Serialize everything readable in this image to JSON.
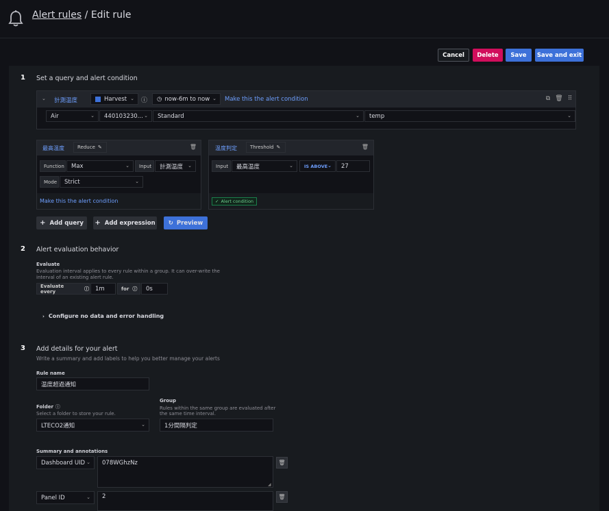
{
  "header": {
    "breadcrumb_link": "Alert rules",
    "breadcrumb_sep": " / ",
    "breadcrumb_current": "Edit rule"
  },
  "toolbar": {
    "cancel": "Cancel",
    "delete": "Delete",
    "save": "Save",
    "save_exit": "Save and exit"
  },
  "step1": {
    "num": "1",
    "title": "Set a query and alert condition",
    "query": {
      "name": "計測温度",
      "datasource": "Harvest",
      "time_range": "now-6m to now",
      "make_condition": "Make this the alert condition",
      "fields": [
        "Air",
        "440103230...",
        "Standard",
        "temp"
      ]
    },
    "expr1": {
      "name": "最高温度",
      "type": "Reduce",
      "function_label": "Function",
      "function_value": "Max",
      "input_label": "Input",
      "input_value": "計測温度",
      "mode_label": "Mode",
      "mode_value": "Strict",
      "make_condition": "Make this the alert condition"
    },
    "expr2": {
      "name": "温度判定",
      "type": "Threshold",
      "input_label": "Input",
      "input_value": "最高温度",
      "op": "IS ABOVE",
      "value": "27",
      "badge": "Alert condition"
    },
    "add_query": "Add query",
    "add_expression": "Add expression",
    "preview": "Preview"
  },
  "step2": {
    "num": "2",
    "title": "Alert evaluation behavior",
    "evaluate_label": "Evaluate",
    "evaluate_desc": "Evaluation interval applies to every rule within a group. It can over-write the interval of an existing alert rule.",
    "every_label": "Evaluate every",
    "every_value": "1m",
    "for_label": "for",
    "for_value": "0s",
    "configure": "Configure no data and error handling"
  },
  "step3": {
    "num": "3",
    "title": "Add details for your alert",
    "subtitle": "Write a summary and add labels to help you better manage your alerts",
    "rule_name_label": "Rule name",
    "rule_name_value": "温度超過通知",
    "folder_label": "Folder",
    "folder_desc": "Select a folder to store your rule.",
    "folder_value": "LTECO2通知",
    "group_label": "Group",
    "group_desc": "Rules within the same group are evaluated after the same time interval.",
    "group_value": "1分間隔判定",
    "summary_label": "Summary and annotations",
    "ann1_key": "Dashboard UID",
    "ann1_value": "078WGhzNz",
    "ann2_key": "Panel ID",
    "ann2_value": "2"
  }
}
